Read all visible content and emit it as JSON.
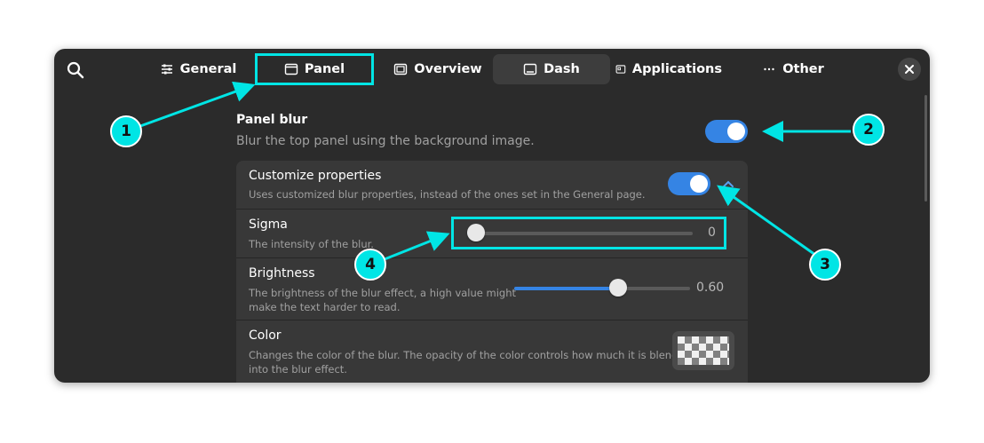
{
  "header": {
    "search_icon": "search-icon",
    "close_icon": "close-icon",
    "tabs": [
      {
        "label": "General",
        "icon": "sliders-icon"
      },
      {
        "label": "Panel",
        "icon": "window-icon"
      },
      {
        "label": "Overview",
        "icon": "overview-icon"
      },
      {
        "label": "Dash",
        "icon": "dash-icon"
      },
      {
        "label": "Applications",
        "icon": "applications-icon"
      },
      {
        "label": "Other",
        "icon": "more-icon"
      }
    ],
    "active_tab": "Dash",
    "highlighted_tab": "Panel"
  },
  "panel_blur": {
    "title": "Panel blur",
    "subtitle": "Blur the top panel using the background image.",
    "enabled": true
  },
  "customize": {
    "title": "Customize properties",
    "subtitle": "Uses customized blur properties, instead of the ones set in the General page.",
    "enabled": true,
    "expanded": true
  },
  "sigma": {
    "title": "Sigma",
    "subtitle": "The intensity of the blur.",
    "value": 0,
    "value_label": "0",
    "fraction": 0
  },
  "brightness": {
    "title": "Brightness",
    "subtitle_line1": "The brightness of the blur effect, a high value might",
    "subtitle_line2": "make the text harder to read.",
    "value": 0.6,
    "value_label": "0.60",
    "fraction": 0.6
  },
  "color": {
    "title": "Color",
    "subtitle_line1": "Changes the color of the blur. The opacity of the color controls how much it is blended",
    "subtitle_line2": "into the blur effect."
  },
  "annotations": {
    "callout_1": "1",
    "callout_2": "2",
    "callout_3": "3",
    "callout_4": "4",
    "accent_color": "#00e5e5"
  },
  "colors": {
    "window_bg": "#2b2b2b",
    "card_bg": "#383838",
    "accent": "#3584e4"
  }
}
